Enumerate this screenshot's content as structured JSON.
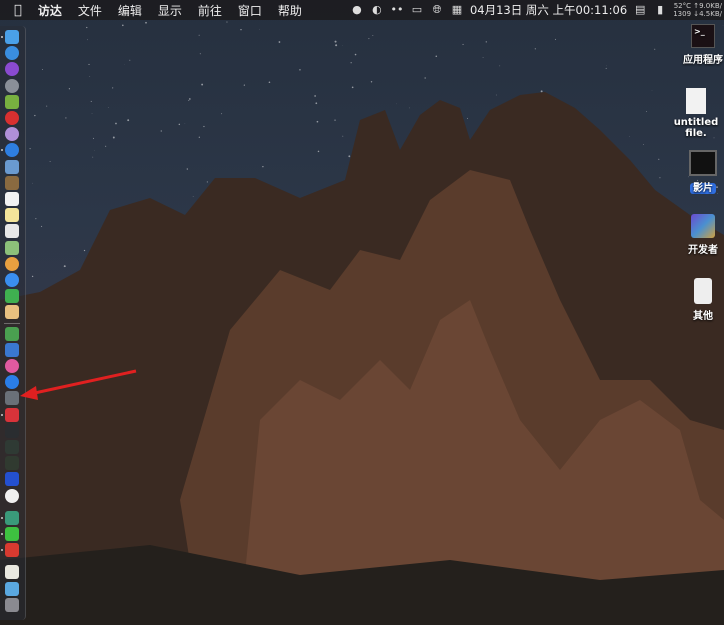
{
  "menubar": {
    "apple": "",
    "items": [
      "访达",
      "文件",
      "编辑",
      "显示",
      "前往",
      "窗口",
      "帮助"
    ],
    "status": {
      "icons": [
        "qq-icon",
        "clock-sync-icon",
        "dots-icon",
        "display-icon",
        "globe-icon",
        "calendar-icon"
      ],
      "datetime": "04月13日 周六 上午00:11:06",
      "right_icons": [
        "screen-icon",
        "bookmark-icon"
      ],
      "net_line1": "52°C ↑9.0KB/",
      "net_line2": "1309 ↓4.5KB/"
    }
  },
  "desktop_icons": [
    {
      "label": "应用程序",
      "icon": "terminal-alias-icon"
    },
    {
      "label": "untitled file.",
      "icon": "text-file-icon"
    },
    {
      "label": "影片",
      "icon": "movies-folder-icon",
      "selected": true
    },
    {
      "label": "开发者",
      "icon": "developer-folder-icon"
    },
    {
      "label": "其他",
      "icon": "other-file-icon"
    }
  ],
  "dock": [
    {
      "name": "finder",
      "color": "#4aa0e8",
      "running": true
    },
    {
      "name": "siri",
      "color": "#3a8ee0",
      "round": true
    },
    {
      "name": "siri-purple",
      "color": "#8a4ad0",
      "round": true
    },
    {
      "name": "launchpad",
      "color": "#8a8f98",
      "round": true
    },
    {
      "name": "android-studio",
      "color": "#78b040"
    },
    {
      "name": "red-app",
      "color": "#d83030",
      "round": true
    },
    {
      "name": "purple-app",
      "color": "#b090d8",
      "round": true
    },
    {
      "name": "safari",
      "color": "#2e7ee0",
      "round": true,
      "running": true
    },
    {
      "name": "preview",
      "color": "#6a9ad0"
    },
    {
      "name": "notebook",
      "color": "#8a6a40"
    },
    {
      "name": "calendar",
      "color": "#f2f2f2"
    },
    {
      "name": "notes",
      "color": "#f3e49a"
    },
    {
      "name": "textedit",
      "color": "#e8e8e8"
    },
    {
      "name": "maps",
      "color": "#8cc07a"
    },
    {
      "name": "photos",
      "color": "#e8a040",
      "round": true
    },
    {
      "name": "messages",
      "color": "#3a8ef0",
      "round": true
    },
    {
      "name": "facetime",
      "color": "#3fb050"
    },
    {
      "name": "script",
      "color": "#e8c080"
    },
    {
      "name": "numbers",
      "color": "#4aa050"
    },
    {
      "name": "keynote",
      "color": "#3a78d0"
    },
    {
      "name": "itunes",
      "color": "#e05aa0",
      "round": true
    },
    {
      "name": "app-store",
      "color": "#2a7ee8",
      "round": true
    },
    {
      "name": "system-preferences",
      "color": "#6a7078"
    },
    {
      "name": "vivaldi",
      "color": "#d8333a",
      "running": true
    },
    {
      "name": "terminal",
      "color": "#2a2d30"
    },
    {
      "name": "activity-monitor",
      "color": "#2f3a34"
    },
    {
      "name": "console",
      "color": "#303a30"
    },
    {
      "name": "vpn",
      "color": "#2450d0"
    },
    {
      "name": "yandex",
      "color": "#f0f0f0",
      "round": true
    },
    {
      "name": "green-app",
      "color": "#3a9a7a",
      "running": true
    },
    {
      "name": "wechat",
      "color": "#3ec040",
      "running": true
    },
    {
      "name": "netease-music",
      "color": "#d83a30",
      "running": true
    },
    {
      "name": "document",
      "color": "#e8e8e0"
    },
    {
      "name": "folder",
      "color": "#5aa8e0"
    },
    {
      "name": "trash",
      "color": "#8a8a90"
    }
  ]
}
